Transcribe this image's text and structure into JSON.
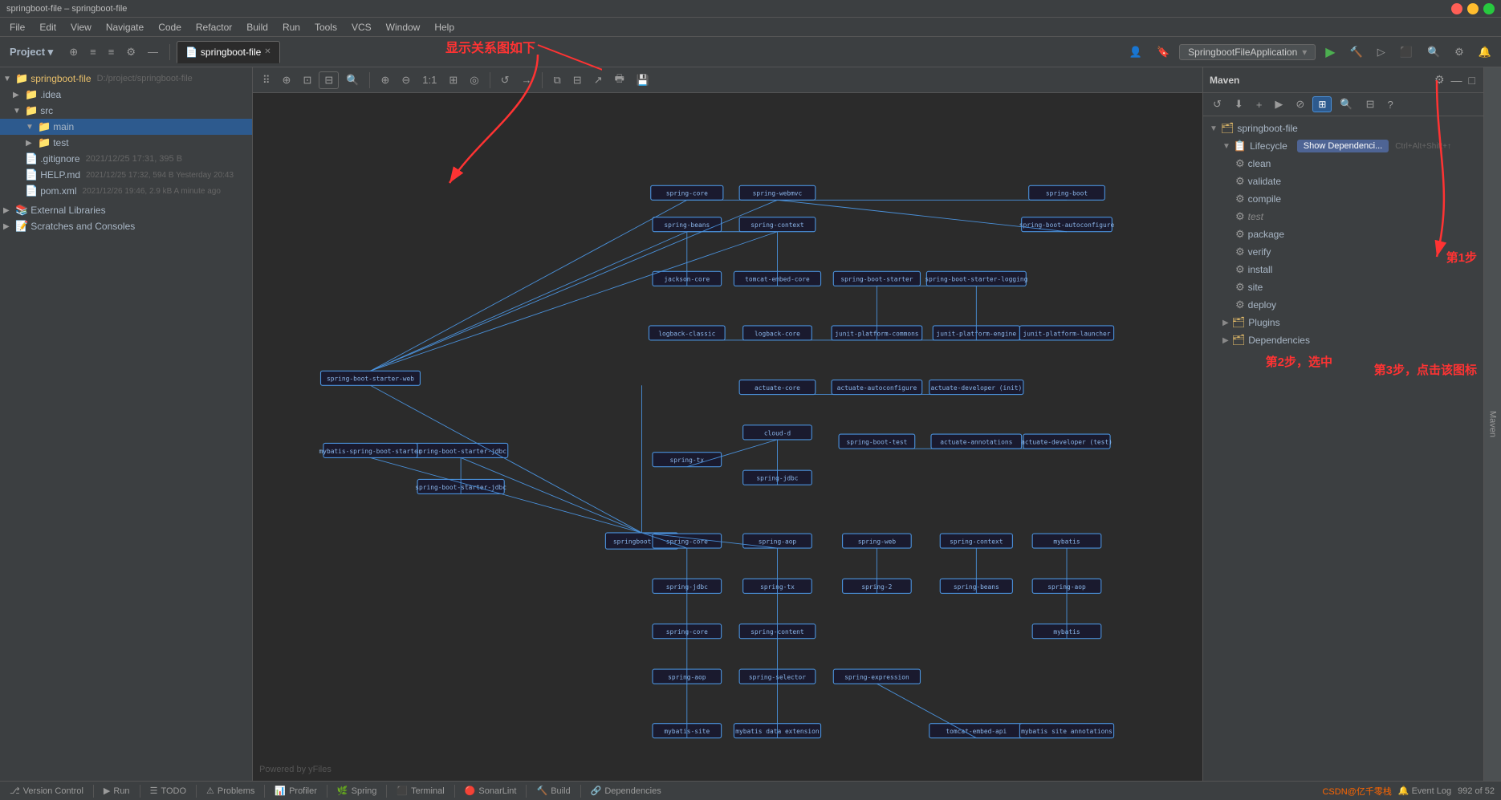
{
  "titlebar": {
    "title": "springboot-file – springboot-file",
    "close": "×",
    "minimize": "–",
    "maximize": "□"
  },
  "menubar": {
    "items": [
      "File",
      "Edit",
      "View",
      "Navigate",
      "Code",
      "Refactor",
      "Build",
      "Run",
      "Tools",
      "VCS",
      "Window",
      "Help"
    ]
  },
  "toolbar": {
    "project_label": "Project",
    "tab_label": "springboot-file",
    "run_config": "SpringbootFileApplication"
  },
  "annotation": {
    "top": "显示关系图如下",
    "step1": "第1步",
    "step2": "第2步，选中",
    "step3": "第3步，点击该图标"
  },
  "sidebar": {
    "title": "Project",
    "root": "springboot-file",
    "root_path": "D:/project/springboot-file",
    "items": [
      {
        "label": ".idea",
        "type": "folder",
        "level": 1
      },
      {
        "label": "src",
        "type": "folder",
        "level": 1,
        "expanded": true
      },
      {
        "label": "main",
        "type": "folder",
        "level": 2,
        "expanded": true
      },
      {
        "label": "test",
        "type": "folder",
        "level": 2
      },
      {
        "label": ".gitignore",
        "type": "file",
        "level": 1,
        "meta": "2021/12/25 17:31, 395 B"
      },
      {
        "label": "HELP.md",
        "type": "file",
        "level": 1,
        "meta": "2021/12/25 17:32, 594 B Yesterday 20:43"
      },
      {
        "label": "pom.xml",
        "type": "file",
        "level": 1,
        "meta": "2021/12/26 19:46, 2.9 kB A minute ago"
      },
      {
        "label": "External Libraries",
        "type": "folder",
        "level": 0
      },
      {
        "label": "Scratches and Consoles",
        "type": "folder",
        "level": 0
      }
    ]
  },
  "maven": {
    "title": "Maven",
    "springboot_file": "springboot-file",
    "lifecycle": {
      "label": "Lifecycle",
      "show_dep_btn": "Show Dependenci...",
      "shortcut": "Ctrl+Alt+Shift+↑",
      "items": [
        "clean",
        "validate",
        "compile",
        "test",
        "package",
        "verify",
        "install",
        "site",
        "deploy"
      ]
    },
    "plugins": {
      "label": "Plugins"
    },
    "dependencies": {
      "label": "Dependencies"
    }
  },
  "diagram": {
    "powered_by": "Powered by yFiles"
  },
  "statusbar": {
    "items": [
      {
        "label": "Version Control",
        "icon": "git"
      },
      {
        "label": "Run",
        "icon": "run"
      },
      {
        "label": "TODO",
        "icon": "todo"
      },
      {
        "label": "Problems",
        "icon": "problems"
      },
      {
        "label": "Profiler",
        "icon": "profiler"
      },
      {
        "label": "Spring",
        "icon": "spring"
      },
      {
        "label": "Terminal",
        "icon": "terminal"
      },
      {
        "label": "SonarLint",
        "icon": "sonar"
      },
      {
        "label": "Build",
        "icon": "build"
      },
      {
        "label": "Dependencies",
        "icon": "dep"
      }
    ],
    "right": {
      "line_col": "992 of 52",
      "csdn": "CSDN@亿千零栈"
    }
  }
}
